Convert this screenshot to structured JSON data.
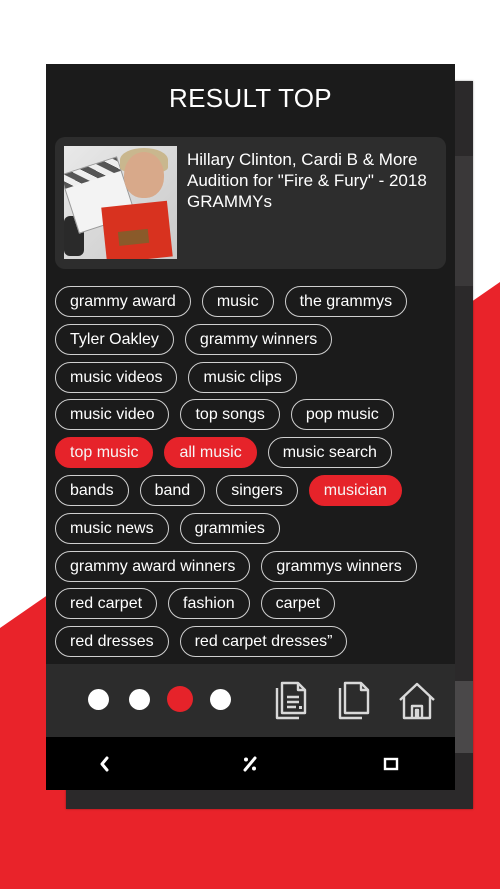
{
  "colors": {
    "accent": "#e6232a",
    "panel": "#1b1b1b",
    "card": "#2d2d2d",
    "bottom_bar": "#2c2c2c",
    "nav_bar": "#000000"
  },
  "header": {
    "title": "RESULT TOP"
  },
  "video": {
    "title": "Hillary Clinton, Cardi B & More Audition for \"Fire & Fury\" - 2018 GRAMMYs",
    "thumbnail": "video-thumbnail"
  },
  "tags": [
    [
      {
        "label": "grammy award",
        "selected": false
      },
      {
        "label": "music",
        "selected": false
      },
      {
        "label": "the grammys",
        "selected": false
      }
    ],
    [
      {
        "label": "Tyler Oakley",
        "selected": false
      },
      {
        "label": "grammy winners",
        "selected": false
      }
    ],
    [
      {
        "label": "music videos",
        "selected": false
      },
      {
        "label": "music clips",
        "selected": false
      }
    ],
    [
      {
        "label": "music video",
        "selected": false
      },
      {
        "label": "top songs",
        "selected": false
      },
      {
        "label": "pop music",
        "selected": false
      }
    ],
    [
      {
        "label": "top music",
        "selected": true
      },
      {
        "label": "all music",
        "selected": true
      },
      {
        "label": "music search",
        "selected": false
      }
    ],
    [
      {
        "label": "bands",
        "selected": false
      },
      {
        "label": "band",
        "selected": false
      },
      {
        "label": "singers",
        "selected": false
      },
      {
        "label": "musician",
        "selected": true
      }
    ],
    [
      {
        "label": "music news",
        "selected": false
      },
      {
        "label": "grammies",
        "selected": false
      }
    ],
    [
      {
        "label": "grammy award winners",
        "selected": false
      },
      {
        "label": "grammys winners",
        "selected": false
      }
    ],
    [
      {
        "label": "red carpet",
        "selected": false
      },
      {
        "label": "fashion",
        "selected": false
      },
      {
        "label": "carpet",
        "selected": false
      }
    ],
    [
      {
        "label": "red dresses",
        "selected": false
      },
      {
        "label": "red carpet dresses”",
        "selected": false
      }
    ]
  ],
  "pager": {
    "total": 4,
    "current": 3
  },
  "toolbar": {
    "icons": [
      "document-stack-icon",
      "copy-icon",
      "home-icon"
    ]
  },
  "navbar": {
    "icons": [
      "back-icon",
      "percent-icon",
      "recents-icon"
    ]
  }
}
